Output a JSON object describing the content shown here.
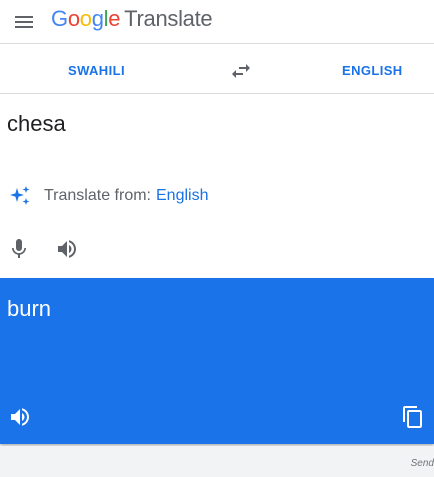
{
  "header": {
    "menu_icon": "hamburger-menu-icon",
    "logo_letters": [
      "G",
      "o",
      "o",
      "g",
      "l",
      "e"
    ],
    "product_name": "Translate"
  },
  "languages": {
    "source": "SWAHILI",
    "target": "ENGLISH",
    "swap_icon": "swap-arrows-icon"
  },
  "source": {
    "text": "chesa",
    "suggestion_icon": "sparkle-icon",
    "suggestion_label": "Translate from:",
    "suggestion_language": "English",
    "mic_icon": "microphone-icon",
    "speaker_icon": "speaker-icon"
  },
  "result": {
    "text": "burn",
    "speaker_icon": "speaker-icon",
    "copy_icon": "copy-icon"
  },
  "footer": {
    "text": "Send"
  },
  "colors": {
    "accent": "#1a73e8",
    "result_background": "#1a73e8",
    "text_primary": "#202124",
    "text_secondary": "#5f6368",
    "footer_background": "#f1f3f4",
    "google_blue": "#4285f4",
    "google_red": "#ea4335",
    "google_yellow": "#fbbc05",
    "google_green": "#34a853"
  }
}
